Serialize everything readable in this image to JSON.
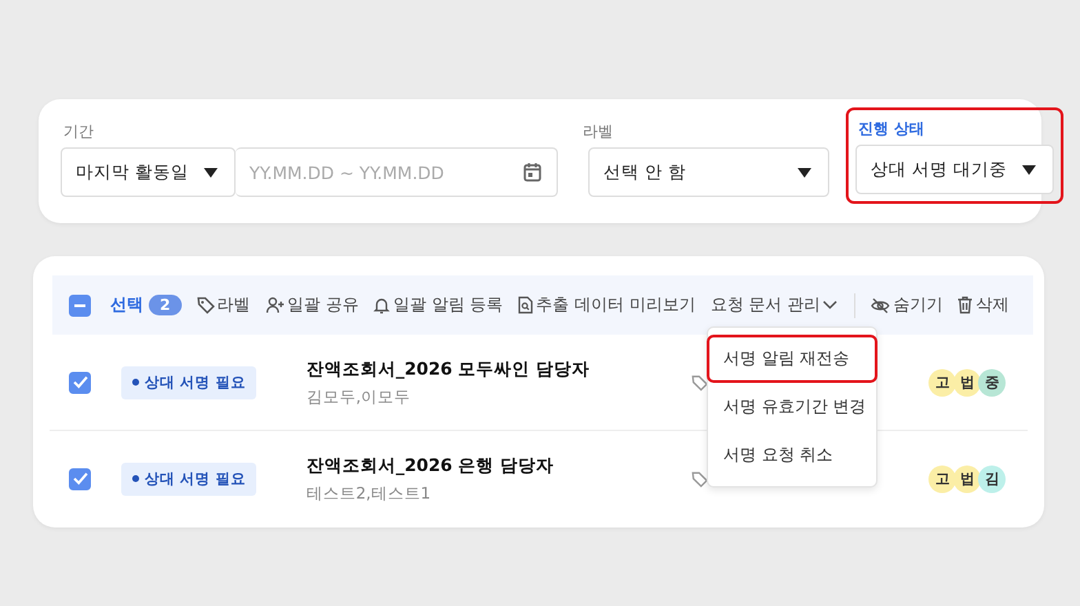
{
  "filters": [
    {
      "label": "기간",
      "highlighted": false,
      "fields": [
        {
          "kind": "select",
          "value": "마지막 활동일"
        },
        {
          "kind": "date",
          "placeholder": "YY.MM.DD ~ YY.MM.DD"
        }
      ]
    },
    {
      "label": "라벨",
      "highlighted": false,
      "fields": [
        {
          "kind": "select",
          "value": "선택 안 함"
        }
      ]
    },
    {
      "label": "진행 상태",
      "highlighted": true,
      "fields": [
        {
          "kind": "select",
          "value": "상대 서명 대기중"
        }
      ]
    }
  ],
  "toolbar": {
    "select_all": {
      "checked": true,
      "partial": true
    },
    "selected_label": "선택",
    "selected_count": "2",
    "actions": [
      {
        "kind": "tag",
        "label": "라벨"
      },
      {
        "kind": "share",
        "label": "일괄 공유"
      },
      {
        "kind": "bell",
        "label": "일괄 알림 등록"
      },
      {
        "kind": "preview",
        "label": "추출 데이터 미리보기"
      },
      {
        "kind": "menu",
        "label": "요청 문서 관리",
        "expanded": true
      },
      {
        "kind": "hide",
        "label": "숨기기"
      },
      {
        "kind": "delete",
        "label": "삭제"
      }
    ]
  },
  "menu": [
    {
      "label": "서명 알림 재전송",
      "highlighted": true
    },
    {
      "label": "서명 유효기간 변경",
      "highlighted": false
    },
    {
      "label": "서명 요청 취소",
      "highlighted": false
    }
  ],
  "rows": [
    {
      "checked": true,
      "status": "상대 서명 필요",
      "title": "잔액조회서_2026 모두싸인 담당자",
      "people": "김모두,이모두",
      "avatars": [
        {
          "initial": "고",
          "color": "#fbeea6"
        },
        {
          "initial": "법",
          "color": "#fbeea6"
        },
        {
          "initial": "중",
          "color": "#b7e6d5"
        }
      ]
    },
    {
      "checked": true,
      "status": "상대 서명 필요",
      "title": "잔액조회서_2026 은행 담당자",
      "people": "테스트2,테스트1",
      "avatars": [
        {
          "initial": "고",
          "color": "#fbeea6"
        },
        {
          "initial": "법",
          "color": "#fbeea6"
        },
        {
          "initial": "김",
          "color": "#bdf0ea"
        }
      ]
    }
  ]
}
